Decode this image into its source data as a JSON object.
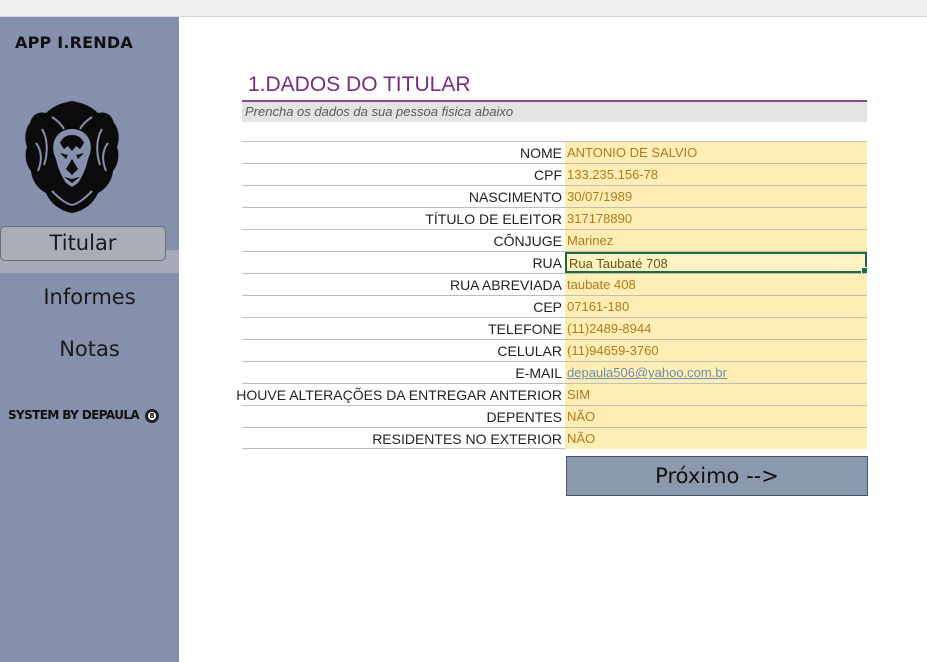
{
  "app": {
    "title": "APP I.RENDA"
  },
  "sidebar": {
    "items": [
      {
        "label": "Titular"
      },
      {
        "label": "Informes"
      },
      {
        "label": "Notas"
      }
    ],
    "credit": "SYSTEM BY DEPAULA",
    "credit_ball": "8"
  },
  "section": {
    "title": "1.DADOS DO TITULAR",
    "subtitle": "Prencha os dados da sua pessoa fisica abaixo"
  },
  "form": {
    "rows": [
      {
        "label": "NOME",
        "value": "ANTONIO DE SALVIO"
      },
      {
        "label": "CPF",
        "value": "133.235.156-78"
      },
      {
        "label": "NASCIMENTO",
        "value": "30/07/1989"
      },
      {
        "label": "TÍTULO DE ELEITOR",
        "value": "317178890"
      },
      {
        "label": "CÔNJUGE",
        "value": "Marinez"
      },
      {
        "label": "RUA",
        "value": "Rua Taubaté 708"
      },
      {
        "label": "RUA ABREVIADA",
        "value": "taubate 408"
      },
      {
        "label": "CEP",
        "value": "07161-180"
      },
      {
        "label": "TELEFONE",
        "value": "(11)2489-8944"
      },
      {
        "label": "CELULAR",
        "value": "(11)94659-3760"
      },
      {
        "label": "E-MAIL",
        "value": "depaula506@yahoo.com.br"
      },
      {
        "label": "HOUVE ALTERAÇÕES  DA ENTREGAR ANTERIOR",
        "value": "SIM"
      },
      {
        "label": "DEPENTES",
        "value": "NÃO"
      },
      {
        "label": "RESIDENTES NO EXTERIOR",
        "value": "NÃO"
      }
    ]
  },
  "buttons": {
    "next": "Próximo -->"
  },
  "colors": {
    "sidebar": "#8590ac",
    "title": "#7a2a7f",
    "input_bg": "#ffeeb3",
    "input_text": "#b07a22",
    "selected_border": "#1f6b3f",
    "button_bg": "#8a9aac"
  },
  "icons": {
    "logo": "lion-head-icon"
  }
}
